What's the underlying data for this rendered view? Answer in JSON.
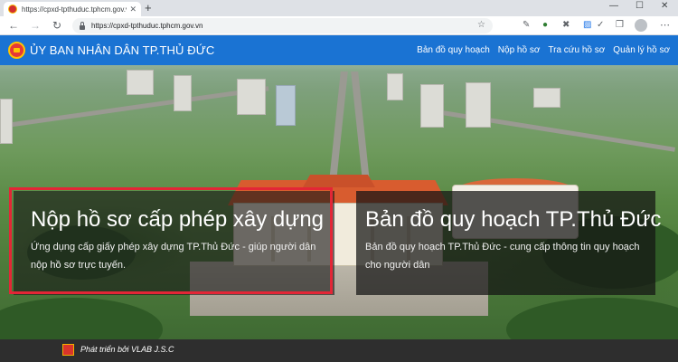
{
  "browser": {
    "tab_title": "https://cpxd-tpthuduc.tphcm.gov.vn",
    "url": "https://cpxd-tpthuduc.tphcm.gov.vn",
    "new_tab_symbol": "+",
    "tab_close_symbol": "✕"
  },
  "header": {
    "title": "ỦY BAN NHÂN DÂN TP.THỦ ĐỨC",
    "nav": [
      {
        "label": "Bản đồ quy hoạch"
      },
      {
        "label": "Nộp hồ sơ"
      },
      {
        "label": "Tra cứu hồ sơ"
      },
      {
        "label": "Quản lý hồ sơ"
      }
    ]
  },
  "cards": [
    {
      "title": "Nộp hồ sơ cấp phép xây dựng",
      "description": "Ứng dụng cấp giấy phép xây dựng TP.Thủ Đức - giúp người dân nộp hồ sơ trực tuyến."
    },
    {
      "title": "Bản đồ quy hoạch TP.Thủ Đức",
      "description": "Bản đồ quy hoạch TP.Thủ Đức - cung cấp thông tin quy hoạch cho người dân"
    }
  ],
  "footer": {
    "text": "Phát triển bởi VLAB J.S.C"
  },
  "colors": {
    "header_bg": "#1a73d3",
    "highlight_border": "#e32636",
    "footer_bg": "#2e2e2e"
  },
  "icons": {
    "back": "arrow-left-icon",
    "forward": "arrow-right-icon",
    "reload": "reload-icon",
    "lock": "lock-icon",
    "bookmark": "star-icon",
    "profile": "avatar",
    "menu": "more-menu-icon"
  }
}
